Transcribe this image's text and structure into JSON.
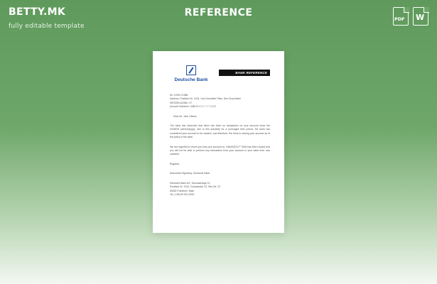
{
  "brand": {
    "name": "BETTY.MK",
    "tagline": "fully editable template"
  },
  "title": "REFERENCE",
  "formats": [
    {
      "icon": "pdf-icon",
      "label": "PDF"
    },
    {
      "icon": "word-icon",
      "label": "W"
    }
  ],
  "document": {
    "bank_name": "Deutsche Bank",
    "ref_label": "BANK REFERENCE",
    "address_lines": [
      "Mr. JOHN COBB",
      "Address: Postfach Nr. 1234, Carl Goerdeler Platz, Den Goschheim",
      "0874054142456 / 47",
      "Account Numbers: 0480 8 4 2 1 7 7 7 2 6 9"
    ],
    "greeting": "Dear Mr. John Gibson",
    "paragraph1": "The bank has observed that there has been no transaction on your account since the 04/05/18 (dd/mm/yyyy). due to this inactivity for a prolonged time period, the bank has considered your account to be inactive, and therefore, the bank is closing your account as of the policy of the bank.",
    "paragraph2": "We are regretful to inform you that your account no. 04849321177 9026 has been closed and you will not be able to perform any transaction from your account in your bank from now onwards.",
    "regards": "Regards,",
    "signature": "Authorized Signatory, Deutsche Bank",
    "footer_lines": [
      "Deutsche Bank AG, Taunusanlage 12,",
      "Postfach Nr. 1234, Colosstraße 23, Otto-Str. 22",
      "60262 Frankfurt / Main",
      "Tel. (+49) 69 910-0000"
    ]
  }
}
